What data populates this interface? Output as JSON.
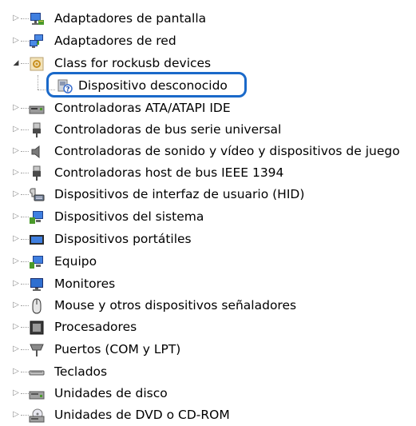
{
  "tree": {
    "items": [
      {
        "label": "Adaptadores de pantalla",
        "icon": "display-adapter-icon",
        "expander": "▷"
      },
      {
        "label": "Adaptadores de red",
        "icon": "network-adapter-icon",
        "expander": "▷"
      },
      {
        "label": "Class for rockusb devices",
        "icon": "rockusb-class-icon",
        "expander": "◢"
      },
      {
        "label": "Dispositivo desconocido",
        "icon": "unknown-device-icon",
        "expander": ""
      },
      {
        "label": "Controladoras ATA/ATAPI IDE",
        "icon": "ide-controller-icon",
        "expander": "▷"
      },
      {
        "label": "Controladoras de bus serie universal",
        "icon": "usb-controller-icon",
        "expander": "▷"
      },
      {
        "label": "Controladoras de sonido y vídeo y dispositivos de juego",
        "icon": "sound-icon",
        "expander": "▷"
      },
      {
        "label": "Controladoras host de bus IEEE 1394",
        "icon": "ieee1394-icon",
        "expander": "▷"
      },
      {
        "label": "Dispositivos de interfaz de usuario (HID)",
        "icon": "hid-icon",
        "expander": "▷"
      },
      {
        "label": "Dispositivos del sistema",
        "icon": "system-devices-icon",
        "expander": "▷"
      },
      {
        "label": "Dispositivos portátiles",
        "icon": "portable-devices-icon",
        "expander": "▷"
      },
      {
        "label": "Equipo",
        "icon": "computer-icon",
        "expander": "▷"
      },
      {
        "label": "Monitores",
        "icon": "monitor-icon",
        "expander": "▷"
      },
      {
        "label": "Mouse y otros dispositivos señaladores",
        "icon": "mouse-icon",
        "expander": "▷"
      },
      {
        "label": "Procesadores",
        "icon": "processor-icon",
        "expander": "▷"
      },
      {
        "label": "Puertos (COM y LPT)",
        "icon": "ports-icon",
        "expander": "▷"
      },
      {
        "label": "Teclados",
        "icon": "keyboard-icon",
        "expander": "▷"
      },
      {
        "label": "Unidades de disco",
        "icon": "disk-drive-icon",
        "expander": "▷"
      },
      {
        "label": "Unidades de DVD o CD-ROM",
        "icon": "dvd-drive-icon",
        "expander": "▷"
      }
    ]
  },
  "colors": {
    "highlight_border": "#1a69c9",
    "expander": "#8c8c8c",
    "tree_lines": "#a0a0a0",
    "text": "#000000"
  }
}
